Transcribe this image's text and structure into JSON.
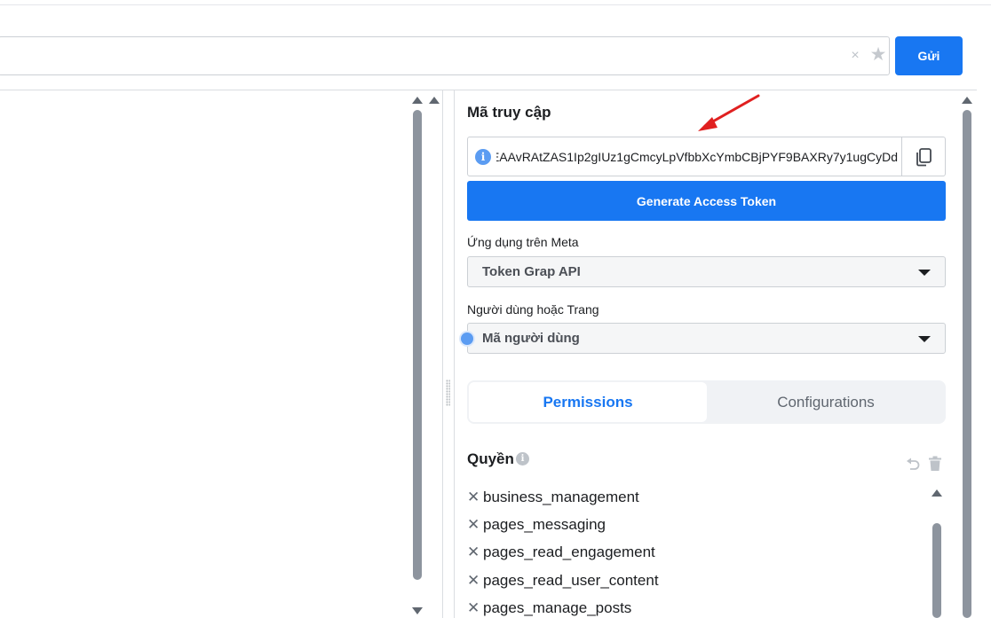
{
  "request_bar": {
    "send_label": "Gửi",
    "clear_icon": "×",
    "favorite_icon": "★"
  },
  "access_token": {
    "title": "Mã truy cập",
    "value": "EAAvRAtZAS1Ip2gIUz1gCmcyLpVfbbXcYmbCBjPYF9BAXRy7y1ugCyDd",
    "info_icon": "i",
    "generate_label": "Generate Access Token"
  },
  "meta_app": {
    "label": "Ứng dụng trên Meta",
    "selected": "Token Grap API"
  },
  "user_or_page": {
    "label": "Người dùng hoặc Trang",
    "selected": "Mã người dùng"
  },
  "tabs": [
    {
      "label": "Permissions",
      "active": true
    },
    {
      "label": "Configurations",
      "active": false
    }
  ],
  "permissions": {
    "title": "Quyền",
    "info_icon": "i",
    "remove_icon": "✕",
    "items": [
      "business_management",
      "pages_messaging",
      "pages_read_engagement",
      "pages_read_user_content",
      "pages_manage_posts"
    ]
  },
  "colors": {
    "primary": "#1877f2",
    "annotation_arrow": "#e02020"
  }
}
